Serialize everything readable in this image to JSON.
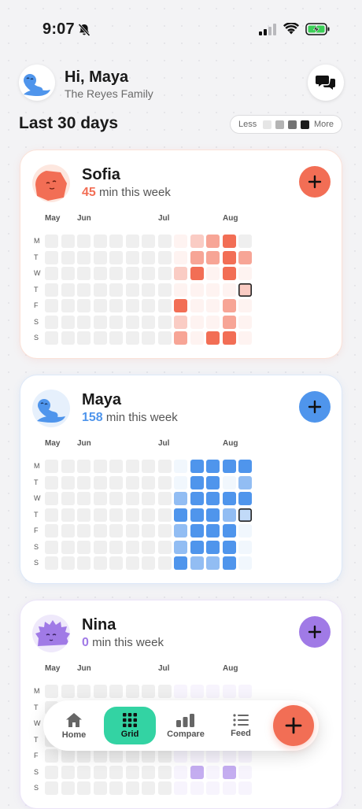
{
  "status_bar": {
    "time": "9:07"
  },
  "header": {
    "greeting": "Hi, Maya",
    "family": "The Reyes Family"
  },
  "section": {
    "title": "Last 30 days"
  },
  "legend": {
    "less": "Less",
    "more": "More",
    "swatches": [
      "#e6e6e6",
      "#b4b4b4",
      "#737373",
      "#1c1c1c"
    ]
  },
  "day_labels": [
    "M",
    "T",
    "W",
    "T",
    "F",
    "S",
    "S"
  ],
  "month_labels": [
    "May",
    "Jun",
    "Jul",
    "Aug"
  ],
  "people": [
    {
      "name": "Sofia",
      "minutes": "45",
      "suffix": "min this week",
      "color": "#f26e55",
      "avatar": "sofia-avatar-icon",
      "levels": [
        [
          0,
          0,
          0,
          0,
          0,
          0,
          0,
          0,
          1,
          2,
          3,
          4,
          0
        ],
        [
          0,
          0,
          0,
          0,
          0,
          0,
          0,
          0,
          1,
          3,
          3,
          4,
          3
        ],
        [
          0,
          0,
          0,
          0,
          0,
          0,
          0,
          0,
          2,
          4,
          1,
          4,
          1
        ],
        [
          0,
          0,
          0,
          0,
          0,
          0,
          0,
          0,
          1,
          1,
          1,
          1,
          2
        ],
        [
          0,
          0,
          0,
          0,
          0,
          0,
          0,
          0,
          4,
          1,
          1,
          3,
          1
        ],
        [
          0,
          0,
          0,
          0,
          0,
          0,
          0,
          0,
          2,
          1,
          1,
          3,
          1
        ],
        [
          0,
          0,
          0,
          0,
          0,
          0,
          0,
          0,
          3,
          1,
          4,
          4,
          1
        ]
      ]
    },
    {
      "name": "Maya",
      "minutes": "158",
      "suffix": "min this week",
      "color": "#4f95ec",
      "avatar": "maya-avatar-icon",
      "levels": [
        [
          0,
          0,
          0,
          0,
          0,
          0,
          0,
          0,
          1,
          4,
          4,
          4,
          4
        ],
        [
          0,
          0,
          0,
          0,
          0,
          0,
          0,
          0,
          1,
          4,
          4,
          1,
          3
        ],
        [
          0,
          0,
          0,
          0,
          0,
          0,
          0,
          0,
          3,
          4,
          4,
          4,
          4
        ],
        [
          0,
          0,
          0,
          0,
          0,
          0,
          0,
          0,
          4,
          4,
          4,
          3,
          2
        ],
        [
          0,
          0,
          0,
          0,
          0,
          0,
          0,
          0,
          3,
          4,
          4,
          4,
          1
        ],
        [
          0,
          0,
          0,
          0,
          0,
          0,
          0,
          0,
          3,
          4,
          4,
          4,
          1
        ],
        [
          0,
          0,
          0,
          0,
          0,
          0,
          0,
          0,
          4,
          3,
          3,
          4,
          1
        ]
      ]
    },
    {
      "name": "Nina",
      "minutes": "0",
      "suffix": "min this week",
      "color": "#a07ae6",
      "avatar": "nina-avatar-icon",
      "levels": [
        [
          0,
          0,
          0,
          0,
          0,
          0,
          0,
          0,
          1,
          1,
          1,
          1,
          1
        ],
        [
          0,
          0,
          0,
          0,
          0,
          0,
          0,
          0,
          1,
          1,
          1,
          1,
          1
        ],
        [
          0,
          0,
          0,
          0,
          0,
          0,
          0,
          0,
          1,
          1,
          1,
          1,
          1
        ],
        [
          0,
          0,
          0,
          0,
          0,
          0,
          0,
          0,
          1,
          1,
          1,
          1,
          1
        ],
        [
          0,
          0,
          0,
          0,
          0,
          0,
          0,
          0,
          1,
          1,
          1,
          1,
          1
        ],
        [
          0,
          0,
          0,
          0,
          0,
          0,
          0,
          0,
          1,
          3,
          1,
          3,
          1
        ],
        [
          0,
          0,
          0,
          0,
          0,
          0,
          0,
          0,
          1,
          1,
          1,
          1,
          1
        ]
      ]
    }
  ],
  "nav": {
    "items": [
      "Home",
      "Grid",
      "Compare",
      "Feed"
    ],
    "active": "Grid"
  }
}
